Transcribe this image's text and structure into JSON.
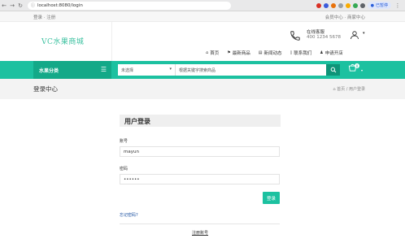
{
  "browser": {
    "url": "localhost:8080/login",
    "profile_label": "已暂停"
  },
  "topbar": {
    "left_text": "登录 · 注册",
    "right_text": "会员中心 · 商家中心"
  },
  "header": {
    "logo": "VC水果商城",
    "hotline_label": "在线客服",
    "hotline_number": "400 1234 5678",
    "nav": [
      "首页",
      "最新商品",
      "新闻动态",
      "联系我们",
      "申请开店"
    ]
  },
  "band": {
    "category_label": "水果分类",
    "select_value": "未选择",
    "search_placeholder": "根据关键字搜索商品",
    "cart_count": "0"
  },
  "page": {
    "title": "登录中心",
    "breadcrumb": "首页  /  用户登录"
  },
  "login": {
    "title": "用户登录",
    "username_label": "账号",
    "username_value": "mayun",
    "password_label": "密码",
    "password_value": "••••••",
    "submit_label": "登录",
    "forgot_label": "忘记密码?",
    "register_label": "注册账号"
  },
  "colors": {
    "accent": "#1cc1a0",
    "accent_dark": "#13a988",
    "link": "#1a4fa0"
  }
}
